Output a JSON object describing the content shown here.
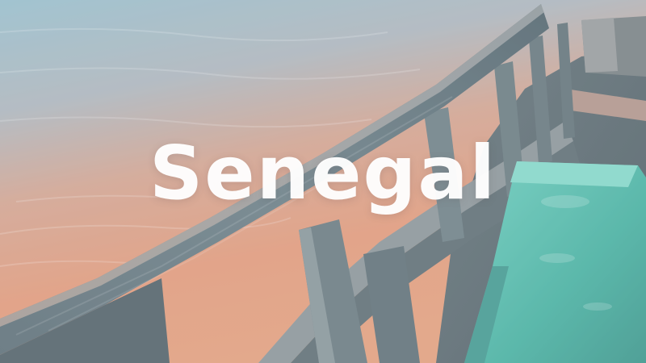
{
  "hero": {
    "title": "Senegal"
  },
  "colors": {
    "water_top": "#86b3c4",
    "water_mid": "#c39a8a",
    "water_bottom": "#df8e6a",
    "wood": "#546a72",
    "wood_light": "#8f9a9c",
    "teal_plank": "#3fb9a6",
    "title_text": "#ffffff"
  },
  "icons": {
    "background": "boat-on-water-photo"
  }
}
